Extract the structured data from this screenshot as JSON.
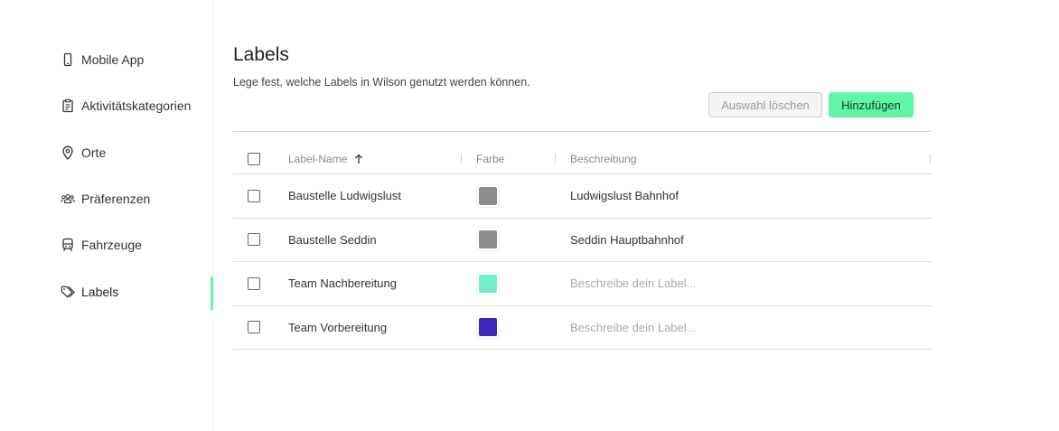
{
  "sidebar": {
    "items": [
      {
        "label": "Mobile App",
        "icon": "smartphone-icon"
      },
      {
        "label": "Aktivitätskategorien",
        "icon": "clipboard-icon"
      },
      {
        "label": "Orte",
        "icon": "map-pin-icon"
      },
      {
        "label": "Präferenzen",
        "icon": "users-icon"
      },
      {
        "label": "Fahrzeuge",
        "icon": "train-icon"
      },
      {
        "label": "Labels",
        "icon": "tag-icon",
        "active": true
      }
    ]
  },
  "header": {
    "title": "Labels",
    "subtitle": "Lege fest, welche Labels in Wilson genutzt werden können."
  },
  "toolbar": {
    "clear_label": "Auswahl löschen",
    "add_label": "Hinzufügen"
  },
  "table": {
    "columns": {
      "name": "Label-Name",
      "color": "Farbe",
      "description": "Beschreibung"
    },
    "rows": [
      {
        "name": "Baustelle Ludwigslust",
        "color": "#8c8c8c",
        "description": "Ludwigslust Bahnhof",
        "is_placeholder": false
      },
      {
        "name": "Baustelle Seddin",
        "color": "#8c8c8c",
        "description": "Seddin Hauptbahnhof",
        "is_placeholder": false
      },
      {
        "name": "Team Nachbereitung",
        "color": "#70f0cc",
        "description": "Beschreibe dein Label...",
        "is_placeholder": true
      },
      {
        "name": "Team Vorbereitung",
        "color": "#3f24b8",
        "description": "Beschreibe dein Label...",
        "is_placeholder": true
      }
    ]
  },
  "colors": {
    "accent": "#5ef5a7"
  }
}
